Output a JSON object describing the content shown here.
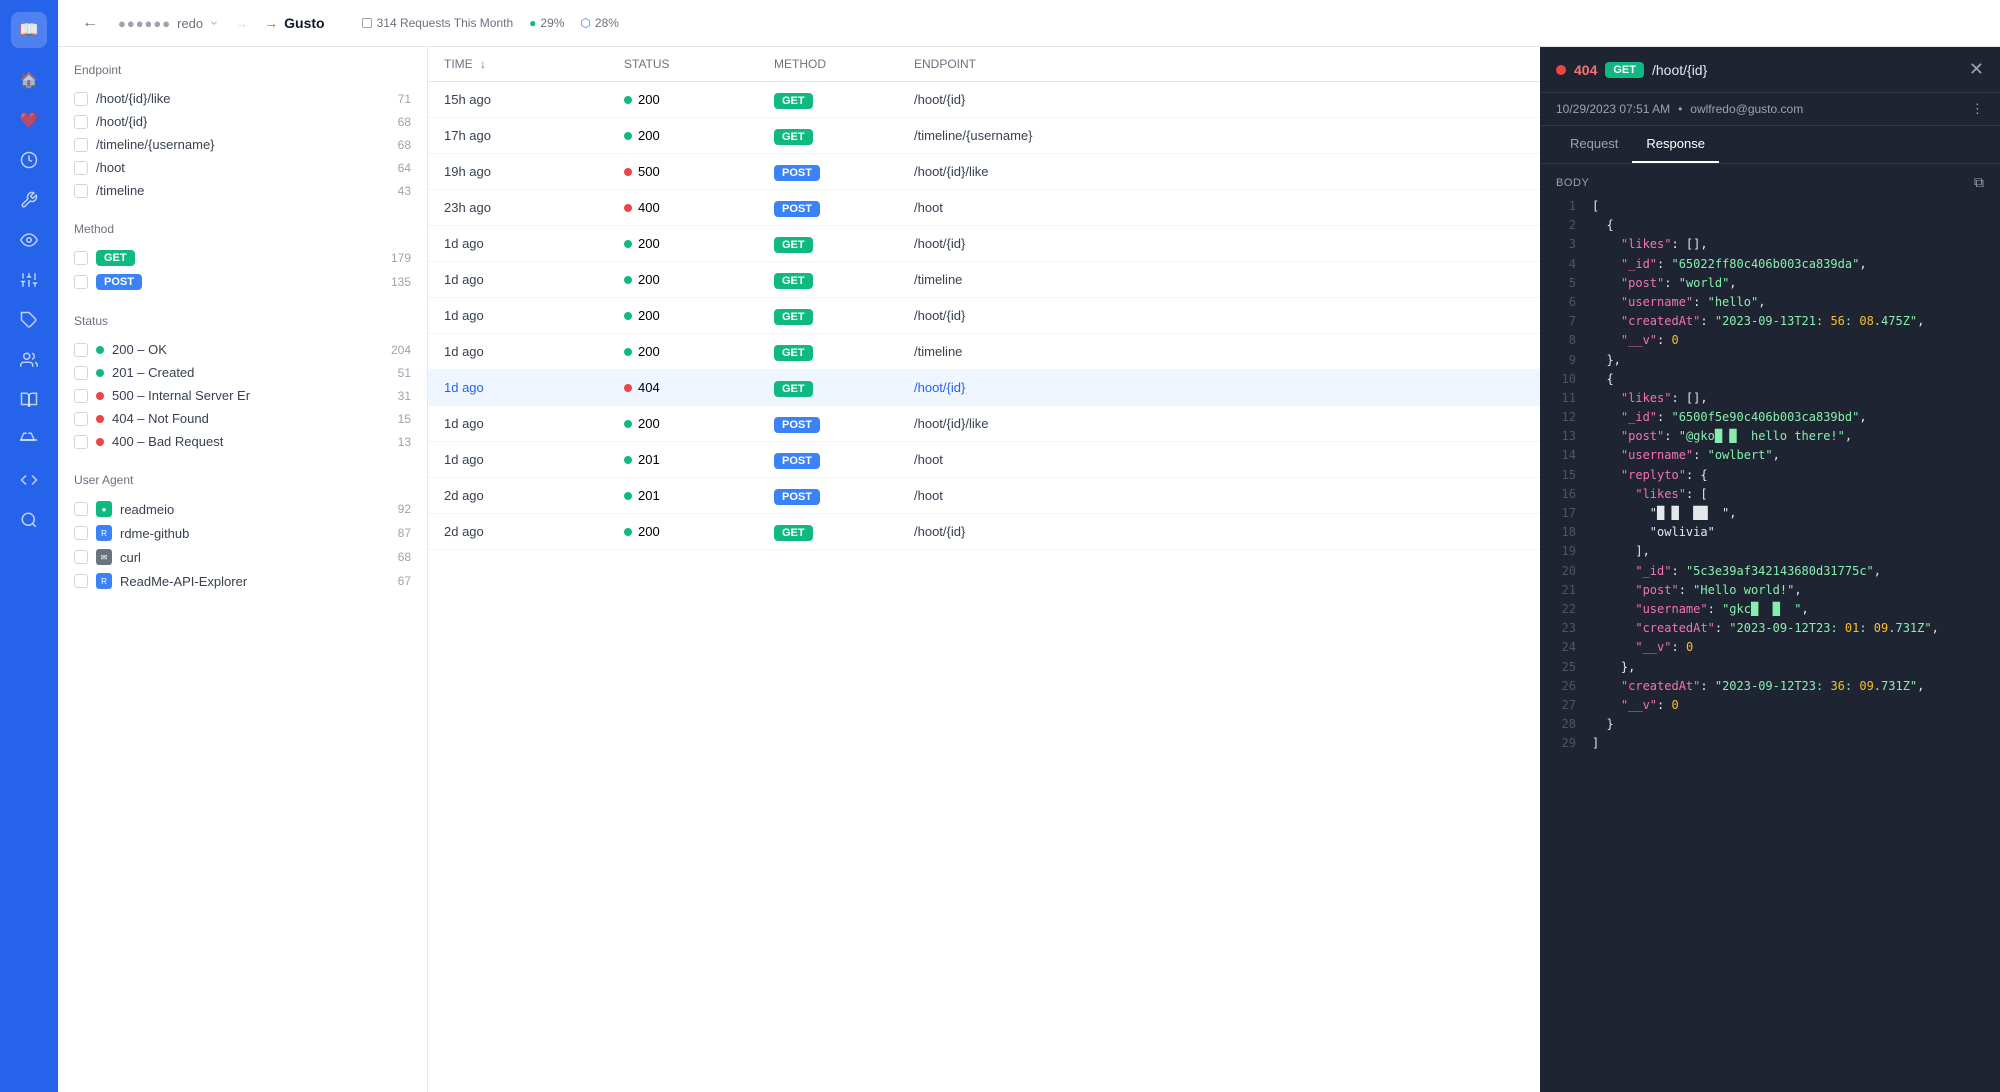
{
  "sidebar": {
    "logo": "📖",
    "icons": [
      "🏠",
      "❤️",
      "🔄",
      "🔧",
      "👁️",
      "🎛️",
      "🏷️",
      "👤",
      "🏠",
      "📚",
      "🧪",
      "◇",
      "🔍"
    ]
  },
  "topbar": {
    "back_label": "←",
    "project_dots": "●●●●●●",
    "project_name": "redo",
    "separator": "→",
    "current_project": "Gusto",
    "stats": {
      "requests": "314 Requests This Month",
      "success_rate": "29%",
      "other_rate": "28%"
    }
  },
  "filters": {
    "endpoint_title": "Endpoint",
    "endpoints": [
      {
        "label": "/hoot/{id}/like",
        "count": 71
      },
      {
        "label": "/hoot/{id}",
        "count": 68
      },
      {
        "label": "/timeline/{username}",
        "count": 68
      },
      {
        "label": "/hoot",
        "count": 64
      },
      {
        "label": "/timeline",
        "count": 43
      }
    ],
    "method_title": "Method",
    "methods": [
      {
        "label": "GET",
        "count": 179,
        "type": "get"
      },
      {
        "label": "POST",
        "count": 135,
        "type": "post"
      }
    ],
    "status_title": "Status",
    "statuses": [
      {
        "label": "200 – OK",
        "count": 204,
        "color": "green"
      },
      {
        "label": "201 – Created",
        "count": 51,
        "color": "green"
      },
      {
        "label": "500 – Internal Server Er",
        "count": 31,
        "color": "red"
      },
      {
        "label": "404 – Not Found",
        "count": 15,
        "color": "red"
      },
      {
        "label": "400 – Bad Request",
        "count": 13,
        "color": "red"
      }
    ],
    "agent_title": "User Agent",
    "agents": [
      {
        "label": "readmeio",
        "count": 92,
        "icon": "🟢"
      },
      {
        "label": "rdme-github",
        "count": 87,
        "icon": "📘"
      },
      {
        "label": "curl",
        "count": 68,
        "icon": "✉️"
      },
      {
        "label": "ReadMe-API-Explorer",
        "count": 67,
        "icon": "📘"
      }
    ]
  },
  "table": {
    "columns": [
      "TIME",
      "STATUS",
      "METHOD",
      "ENDPOINT"
    ],
    "rows": [
      {
        "time": "15h ago",
        "status": "200",
        "status_color": "green",
        "method": "GET",
        "method_type": "get",
        "endpoint": "/hoot/{id}",
        "selected": false
      },
      {
        "time": "17h ago",
        "status": "200",
        "status_color": "green",
        "method": "GET",
        "method_type": "get",
        "endpoint": "/timeline/{username}",
        "selected": false
      },
      {
        "time": "19h ago",
        "status": "500",
        "status_color": "red",
        "method": "POST",
        "method_type": "post",
        "endpoint": "/hoot/{id}/like",
        "selected": false
      },
      {
        "time": "23h ago",
        "status": "400",
        "status_color": "red",
        "method": "POST",
        "method_type": "post",
        "endpoint": "/hoot",
        "selected": false
      },
      {
        "time": "1d ago",
        "status": "200",
        "status_color": "green",
        "method": "GET",
        "method_type": "get",
        "endpoint": "/hoot/{id}",
        "selected": false
      },
      {
        "time": "1d ago",
        "status": "200",
        "status_color": "green",
        "method": "GET",
        "method_type": "get",
        "endpoint": "/timeline",
        "selected": false
      },
      {
        "time": "1d ago",
        "status": "200",
        "status_color": "green",
        "method": "GET",
        "method_type": "get",
        "endpoint": "/hoot/{id}",
        "selected": false
      },
      {
        "time": "1d ago",
        "status": "200",
        "status_color": "green",
        "method": "GET",
        "method_type": "get",
        "endpoint": "/timeline",
        "selected": false
      },
      {
        "time": "1d ago",
        "status": "404",
        "status_color": "red",
        "method": "GET",
        "method_type": "get",
        "endpoint": "/hoot/{id}",
        "selected": true
      },
      {
        "time": "1d ago",
        "status": "200",
        "status_color": "green",
        "method": "POST",
        "method_type": "post",
        "endpoint": "/hoot/{id}/like",
        "selected": false
      },
      {
        "time": "1d ago",
        "status": "201",
        "status_color": "green",
        "method": "POST",
        "method_type": "post",
        "endpoint": "/hoot",
        "selected": false
      },
      {
        "time": "2d ago",
        "status": "201",
        "status_color": "green",
        "method": "POST",
        "method_type": "post",
        "endpoint": "/hoot",
        "selected": false
      },
      {
        "time": "2d ago",
        "status": "200",
        "status_color": "green",
        "method": "GET",
        "method_type": "get",
        "endpoint": "/hoot/{id}",
        "selected": false
      }
    ]
  },
  "response_panel": {
    "status_code": "404",
    "method": "GET",
    "endpoint": "/hoot/{id}",
    "timestamp": "10/29/2023 07:51 AM",
    "user": "owlfredo@gusto.com",
    "tab_request": "Request",
    "tab_response": "Response",
    "body_label": "BODY",
    "code_lines": [
      {
        "num": 1,
        "content": "["
      },
      {
        "num": 2,
        "content": "  {"
      },
      {
        "num": 3,
        "content": "    \"likes\": [],"
      },
      {
        "num": 4,
        "content": "    \"_id\": \"65022ff80c406b003ca839da\","
      },
      {
        "num": 5,
        "content": "    \"post\": \"world\","
      },
      {
        "num": 6,
        "content": "    \"username\": \"hello\","
      },
      {
        "num": 7,
        "content": "    \"createdAt\": \"2023-09-13T21:56:08.475Z\","
      },
      {
        "num": 8,
        "content": "    \"__v\": 0"
      },
      {
        "num": 9,
        "content": "  },"
      },
      {
        "num": 10,
        "content": "  {"
      },
      {
        "num": 11,
        "content": "    \"likes\": [],"
      },
      {
        "num": 12,
        "content": "    \"_id\": \"6500f5e90c406b003ca839bd\","
      },
      {
        "num": 13,
        "content": "    \"post\": \"@gko█ █  hello there!\","
      },
      {
        "num": 14,
        "content": "    \"username\": \"owlbert\","
      },
      {
        "num": 15,
        "content": "    \"replyto\": {"
      },
      {
        "num": 16,
        "content": "      \"likes\": ["
      },
      {
        "num": 17,
        "content": "        \"█ █  ██  \","
      },
      {
        "num": 18,
        "content": "        \"owlivia\""
      },
      {
        "num": 19,
        "content": "      ],"
      },
      {
        "num": 20,
        "content": "      \"_id\": \"5c3e39af342143680d31775c\","
      },
      {
        "num": 21,
        "content": "      \"post\": \"Hello world!\","
      },
      {
        "num": 22,
        "content": "      \"username\": \"gkc█  █  \","
      },
      {
        "num": 23,
        "content": "      \"createdAt\": \"2023-09-12T23:01:09.731Z\","
      },
      {
        "num": 24,
        "content": "      \"__v\": 0"
      },
      {
        "num": 25,
        "content": "    },"
      },
      {
        "num": 26,
        "content": "    \"createdAt\": \"2023-09-12T23:36:09.731Z\","
      },
      {
        "num": 27,
        "content": "    \"__v\": 0"
      },
      {
        "num": 28,
        "content": "  }"
      },
      {
        "num": 29,
        "content": "]"
      }
    ]
  }
}
